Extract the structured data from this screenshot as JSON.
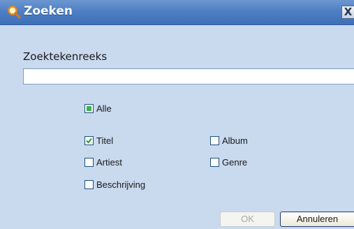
{
  "dialog": {
    "title": "Zoeken",
    "title_icon": "magnifier-icon",
    "close_label": "X"
  },
  "search": {
    "label": "Zoektekenreeks",
    "value": "",
    "placeholder": ""
  },
  "filters": {
    "all": {
      "label": "Alle",
      "state": "mixed"
    },
    "title": {
      "label": "Titel",
      "checked": true
    },
    "album": {
      "label": "Album",
      "checked": false
    },
    "artist": {
      "label": "Artiest",
      "checked": false
    },
    "genre": {
      "label": "Genre",
      "checked": false
    },
    "description": {
      "label": "Beschrijving",
      "checked": false
    }
  },
  "buttons": {
    "ok_label": "OK",
    "ok_enabled": false,
    "cancel_label": "Annuleren"
  },
  "colors": {
    "titlebar": "#4f7fc3",
    "dialog_bg": "#c9d9ee",
    "check_green": "#3bb04d"
  }
}
